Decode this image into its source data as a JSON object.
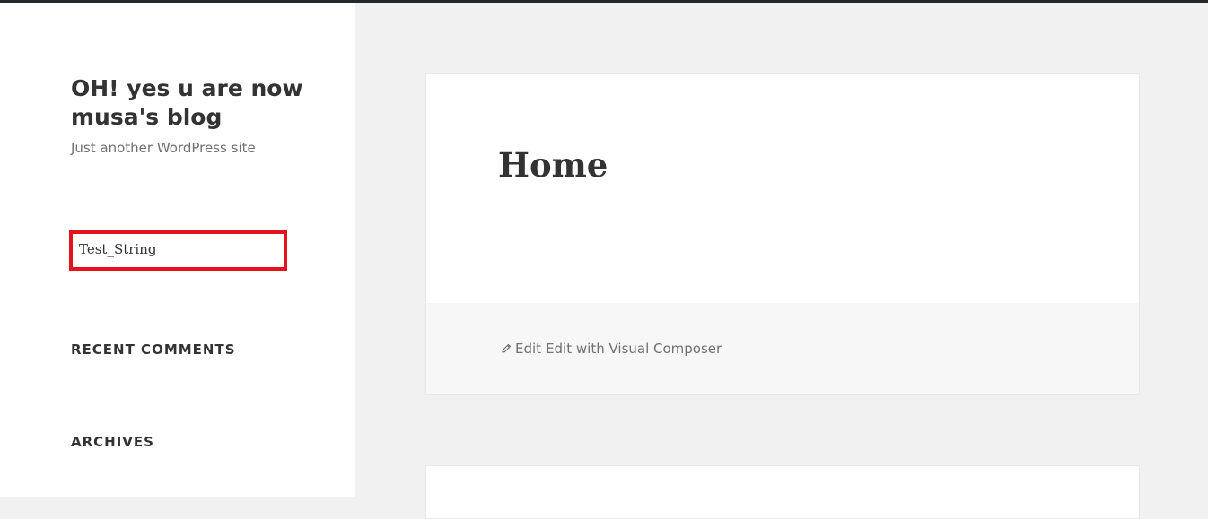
{
  "site": {
    "title": "OH! yes u are now musa's blog",
    "description": "Just another WordPress site"
  },
  "sidebar": {
    "text_widget": "Test_String",
    "widgets": [
      {
        "title": "RECENT COMMENTS"
      },
      {
        "title": "ARCHIVES"
      }
    ]
  },
  "main": {
    "article": {
      "title": "Home",
      "edit_label": "Edit",
      "visual_composer_label": "Edit with Visual Composer"
    }
  },
  "colors": {
    "highlight_border": "#e3131d",
    "topbar": "#23282d",
    "background": "#f1f1f1"
  },
  "icons": {
    "edit": "pencil-icon"
  }
}
